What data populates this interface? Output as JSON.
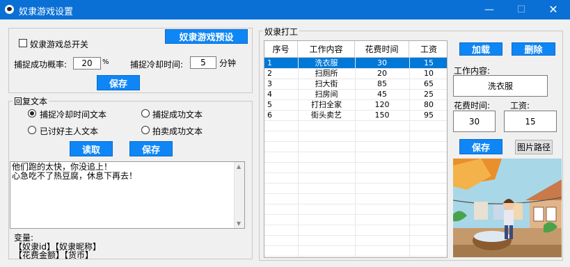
{
  "window": {
    "title": "奴隶游戏设置",
    "min": "—",
    "max": "☐",
    "close": "✕"
  },
  "settings": {
    "master_switch_label": "奴隶游戏总开关",
    "preset_button": "奴隶游戏预设",
    "catch_rate_label": "捕捉成功概率:",
    "catch_rate_value": "20",
    "catch_rate_unit": "%",
    "cooldown_label": "捕捉冷却时间:",
    "cooldown_value": "5",
    "cooldown_unit": "分钟",
    "save_button": "保存"
  },
  "reply": {
    "group_title": "回复文本",
    "options": [
      {
        "label": "捕捉冷却时间文本",
        "selected": true
      },
      {
        "label": "捕捉成功文本",
        "selected": false
      },
      {
        "label": "已讨好主人文本",
        "selected": false
      },
      {
        "label": "拍卖成功文本",
        "selected": false
      }
    ],
    "read_button": "读取",
    "save_button": "保存",
    "text": "他们跑的太快，你没追上！\n心急吃不了热豆腐，休息下再去！",
    "variables_title": "变量:",
    "variables_line1": "【奴隶id】【奴隶昵称】",
    "variables_line2": "【花费金额】【货币】"
  },
  "work": {
    "group_title": "奴隶打工",
    "columns": [
      "序号",
      "工作内容",
      "花费时间",
      "工资"
    ],
    "rows": [
      [
        "1",
        "洗衣服",
        "30",
        "15"
      ],
      [
        "2",
        "扫厕所",
        "20",
        "10"
      ],
      [
        "3",
        "扫大街",
        "85",
        "65"
      ],
      [
        "4",
        "扫房间",
        "45",
        "25"
      ],
      [
        "5",
        "打扫全家",
        "120",
        "80"
      ],
      [
        "6",
        "街头卖艺",
        "150",
        "95"
      ]
    ],
    "selected_row": 0,
    "add_button": "加载",
    "delete_button": "删除",
    "content_label": "工作内容:",
    "content_value": "洗衣服",
    "time_label": "花费时间:",
    "time_value": "30",
    "wage_label": "工资:",
    "wage_value": "15",
    "save_button": "保存",
    "image_path_button": "图片路径"
  }
}
